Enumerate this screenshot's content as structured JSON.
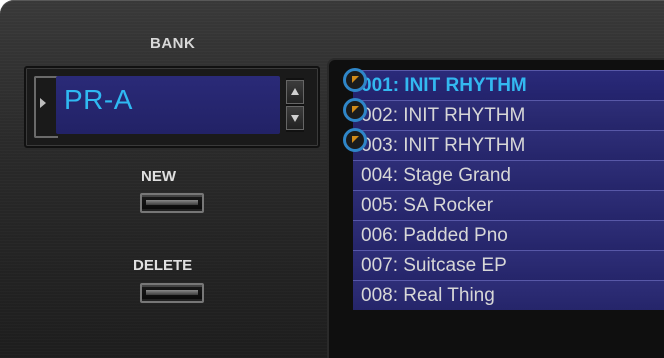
{
  "bank": {
    "label": "BANK",
    "value": "PR-A"
  },
  "buttons": {
    "new_label": "NEW",
    "delete_label": "DELETE"
  },
  "patches": [
    {
      "label": "001: INIT RHYTHM",
      "selected": true,
      "marked": true
    },
    {
      "label": "002: INIT RHYTHM",
      "selected": false,
      "marked": true
    },
    {
      "label": "003: INIT RHYTHM",
      "selected": false,
      "marked": true
    },
    {
      "label": "004: Stage Grand",
      "selected": false,
      "marked": false
    },
    {
      "label": "005: SA Rocker",
      "selected": false,
      "marked": false
    },
    {
      "label": "006: Padded Pno",
      "selected": false,
      "marked": false
    },
    {
      "label": "007: Suitcase EP",
      "selected": false,
      "marked": false
    },
    {
      "label": "008: Real Thing",
      "selected": false,
      "marked": false
    }
  ],
  "colors": {
    "selected_text": "#33b8f0",
    "display_bg": "#27276e",
    "marker_ring": "#2f86c8",
    "marker_flag": "#d08a1a"
  }
}
